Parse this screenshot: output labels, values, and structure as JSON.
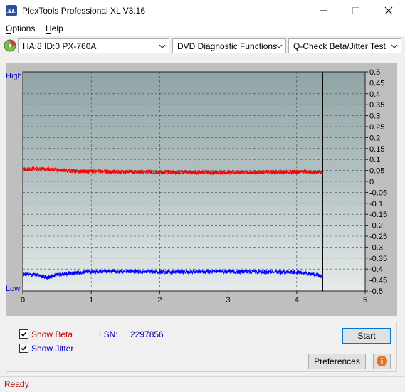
{
  "window": {
    "title": "PlexTools Professional XL V3.16",
    "icon_label": "XL"
  },
  "menu": {
    "items": [
      "Options",
      "Help"
    ]
  },
  "toolbar": {
    "drive": "HA:8 ID:0  PX-760A",
    "function": "DVD Diagnostic Functions",
    "test": "Q-Check Beta/Jitter Test"
  },
  "chart_labels": {
    "high": "High",
    "low": "Low"
  },
  "chart_data": {
    "type": "line",
    "title": "",
    "xlabel": "",
    "ylabel": "",
    "xlim": [
      0,
      5
    ],
    "ylim": [
      -0.5,
      0.5
    ],
    "x_ticks": [
      "0",
      "1",
      "2",
      "3",
      "4",
      "5"
    ],
    "y_ticks": [
      "0.5",
      "0.45",
      "0.4",
      "0.35",
      "0.3",
      "0.25",
      "0.2",
      "0.15",
      "0.1",
      "0.05",
      "0",
      "-0.05",
      "-0.1",
      "-0.15",
      "-0.2",
      "-0.25",
      "-0.3",
      "-0.35",
      "-0.4",
      "-0.45",
      "-0.5"
    ],
    "end_marker_x": 4.38,
    "grid": true,
    "series": [
      {
        "color": "#ff0000",
        "x": [
          0,
          0.2,
          0.4,
          0.6,
          0.8,
          1.0,
          1.5,
          2.0,
          2.5,
          3.0,
          3.5,
          4.0,
          4.3,
          4.38
        ],
        "y": [
          0.055,
          0.058,
          0.055,
          0.05,
          0.048,
          0.045,
          0.044,
          0.042,
          0.042,
          0.041,
          0.042,
          0.044,
          0.042,
          0.04
        ]
      },
      {
        "color": "#0000ff",
        "x": [
          0,
          0.2,
          0.35,
          0.5,
          0.7,
          1.0,
          1.5,
          2.0,
          2.5,
          3.0,
          3.5,
          4.0,
          4.3,
          4.38
        ],
        "y": [
          -0.425,
          -0.425,
          -0.44,
          -0.425,
          -0.42,
          -0.412,
          -0.41,
          -0.413,
          -0.412,
          -0.412,
          -0.413,
          -0.415,
          -0.425,
          -0.435
        ]
      }
    ]
  },
  "controls": {
    "show_beta": "Show Beta",
    "show_jitter": "Show Jitter",
    "lsn_label": "LSN:",
    "lsn_value": "2297856",
    "start": "Start",
    "preferences": "Preferences"
  },
  "colors": {
    "beta": "#cc0000",
    "jitter": "#0000cc"
  },
  "status": {
    "text": "Ready"
  }
}
